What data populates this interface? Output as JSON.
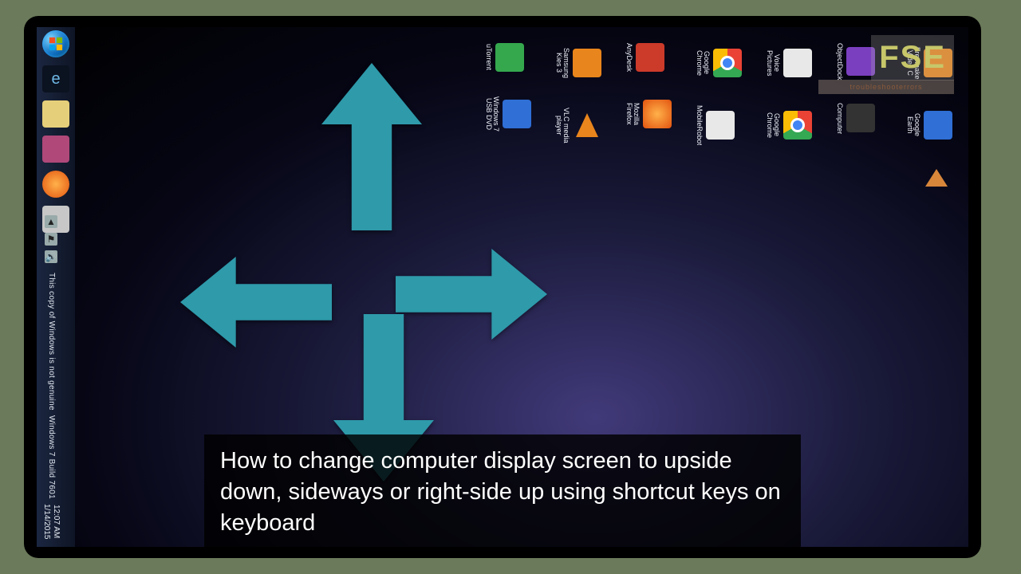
{
  "taskbar": {
    "items": [
      {
        "name": "start",
        "label": "Start"
      },
      {
        "name": "ie",
        "label": "Internet Explorer"
      },
      {
        "name": "explorer",
        "label": "File Explorer"
      },
      {
        "name": "app-pink",
        "label": "App"
      },
      {
        "name": "firefox",
        "label": "Firefox"
      },
      {
        "name": "app-grey",
        "label": "App"
      }
    ]
  },
  "desktop_icons": [
    {
      "label": "Freemake Video C",
      "style": "i-orange"
    },
    {
      "label": "Google Earth",
      "style": "i-blue"
    },
    {
      "label": "ObjectDock",
      "style": "i-purple"
    },
    {
      "label": "Computer",
      "style": "i-dark"
    },
    {
      "label": "Voice Pictures",
      "style": "i-white"
    },
    {
      "label": "Google Chrome",
      "style": "i-chrome"
    },
    {
      "label": "Google Chrome",
      "style": "i-chrome"
    },
    {
      "label": "MobileRobot",
      "style": "i-white"
    },
    {
      "label": "AnyDesk",
      "style": "i-red"
    },
    {
      "label": "Mozilla Firefox",
      "style": "i-ff"
    },
    {
      "label": "Samsung Kies 3",
      "style": "i-orange"
    },
    {
      "label": "VLC media player",
      "style": "i-vlc"
    },
    {
      "label": "uTorrent",
      "style": "i-green"
    },
    {
      "label": "Windows 7 USB DVD",
      "style": "i-blue"
    }
  ],
  "arrows": [
    "up",
    "left",
    "right",
    "down"
  ],
  "watermark": {
    "line1": "This copy of Windows is not genuine",
    "build": "Windows 7  Build 7601",
    "time": "12:07 AM",
    "date": "1/14/2015"
  },
  "brand": {
    "logo": "FSE",
    "sub": "troubleshooterrors"
  },
  "caption": "How to change computer display screen to upside down, sideways or right-side up using shortcut keys on keyboard"
}
